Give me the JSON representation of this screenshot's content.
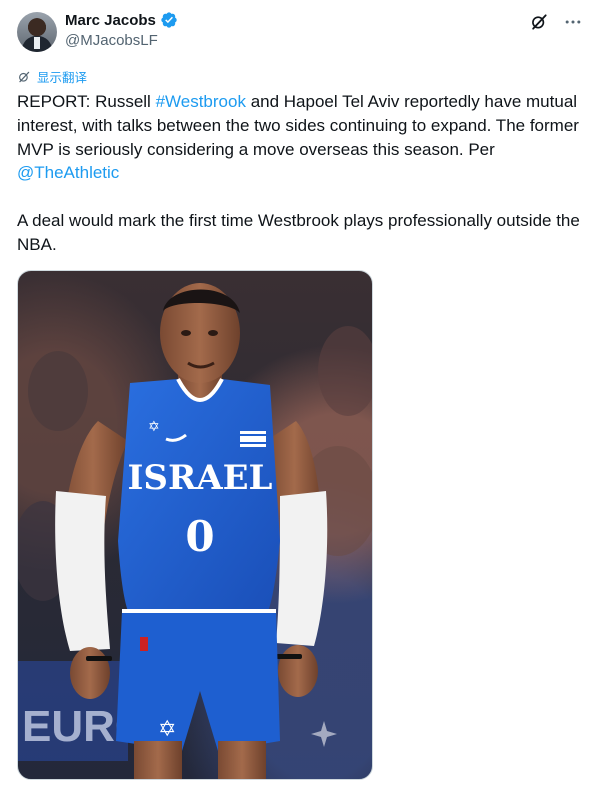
{
  "author": {
    "name": "Marc Jacobs",
    "handle": "@MJacobsLF",
    "verified": true
  },
  "translate_label": "显示翻译",
  "tweet": {
    "line1_a": "REPORT: Russell ",
    "hashtag": "#Westbrook",
    "line1_b": " and Hapoel Tel Aviv reportedly have mutual interest, with talks between the two sides continuing to expand. The former MVP is seriously considering a move overseas this season. Per ",
    "mention": "@TheAthletic",
    "para2": "A deal would mark the first time Westbrook plays professionally outside the NBA."
  },
  "media": {
    "jersey_text": "ISRAEL",
    "jersey_number": "0",
    "banner_text": "EURO"
  },
  "colors": {
    "accent": "#1d9bf0",
    "jersey": "#1e5fd0",
    "text": "#0f1419",
    "muted": "#536471"
  },
  "icons": {
    "verified": "verified-badge-icon",
    "grok": "grok-icon",
    "more": "more-icon",
    "translate": "translate-icon"
  }
}
